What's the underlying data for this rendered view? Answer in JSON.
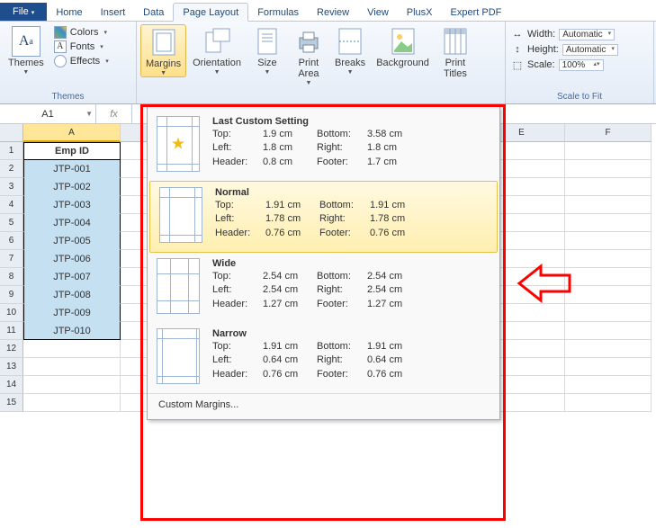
{
  "tabs": {
    "file": "File",
    "home": "Home",
    "insert": "Insert",
    "data": "Data",
    "pagelayout": "Page Layout",
    "formulas": "Formulas",
    "review": "Review",
    "view": "View",
    "plusx": "PlusX",
    "expertpdf": "Expert PDF"
  },
  "ribbon": {
    "themes": {
      "label": "Themes",
      "btn": "Themes",
      "colors": "Colors",
      "fonts": "Fonts",
      "effects": "Effects"
    },
    "pagesetup": {
      "margins": "Margins",
      "orientation": "Orientation",
      "size": "Size",
      "printarea": "Print\nArea",
      "breaks": "Breaks",
      "background": "Background",
      "printtitles": "Print\nTitles"
    },
    "scale": {
      "label": "Scale to Fit",
      "width": "Width:",
      "height": "Height:",
      "scale": "Scale:",
      "auto": "Automatic",
      "pct": "100%"
    }
  },
  "namebox": "A1",
  "colA": "A",
  "colE": "E",
  "colF": "F",
  "rows": [
    "1",
    "2",
    "3",
    "4",
    "5",
    "6",
    "7",
    "8",
    "9",
    "10",
    "11",
    "12",
    "13",
    "14",
    "15"
  ],
  "header": "Emp ID",
  "data": [
    "JTP-001",
    "JTP-002",
    "JTP-003",
    "JTP-004",
    "JTP-005",
    "JTP-006",
    "JTP-007",
    "JTP-008",
    "JTP-009",
    "JTP-010"
  ],
  "margins": {
    "options": [
      {
        "title": "Last Custom Setting",
        "top": "1.9 cm",
        "bottom": "3.58 cm",
        "left": "1.8 cm",
        "right": "1.8 cm",
        "header": "0.8 cm",
        "footer": "1.7 cm",
        "star": true
      },
      {
        "title": "Normal",
        "top": "1.91 cm",
        "bottom": "1.91 cm",
        "left": "1.78 cm",
        "right": "1.78 cm",
        "header": "0.76 cm",
        "footer": "0.76 cm"
      },
      {
        "title": "Wide",
        "top": "2.54 cm",
        "bottom": "2.54 cm",
        "left": "2.54 cm",
        "right": "2.54 cm",
        "header": "1.27 cm",
        "footer": "1.27 cm"
      },
      {
        "title": "Narrow",
        "top": "1.91 cm",
        "bottom": "1.91 cm",
        "left": "0.64 cm",
        "right": "0.64 cm",
        "header": "0.76 cm",
        "footer": "0.76 cm"
      }
    ],
    "lbl_top": "Top:",
    "lbl_bottom": "Bottom:",
    "lbl_left": "Left:",
    "lbl_right": "Right:",
    "lbl_header": "Header:",
    "lbl_footer": "Footer:",
    "custom": "Custom Margins..."
  }
}
